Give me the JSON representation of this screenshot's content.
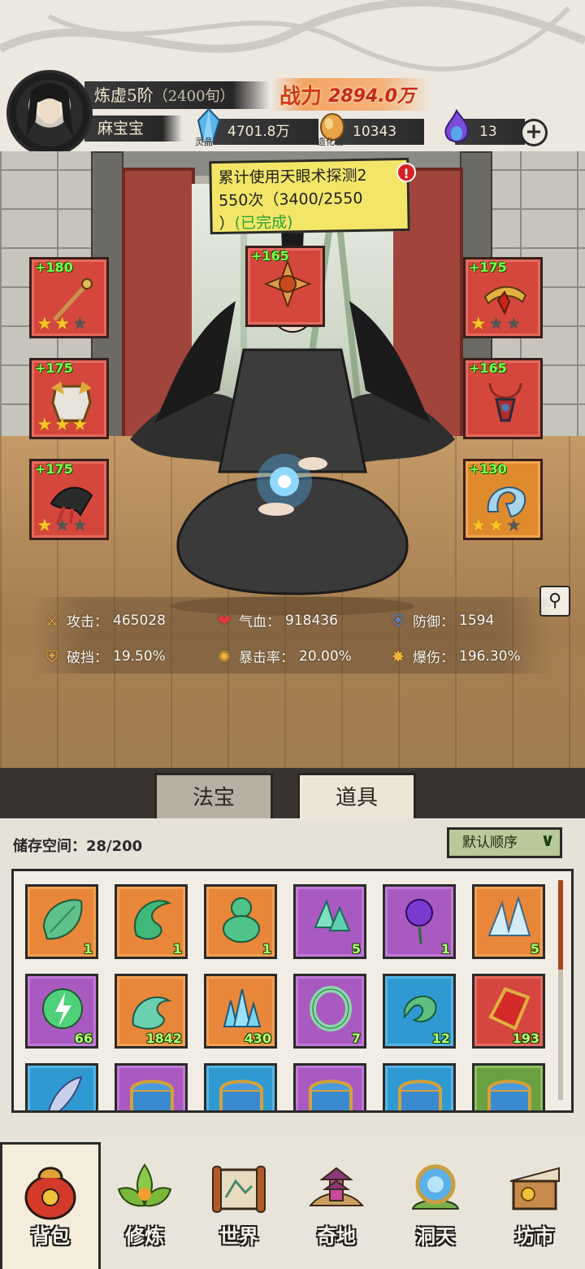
{
  "header": {
    "rank": "炼虚5阶",
    "rank_sub": "（2400旬）",
    "player_name": "麻宝宝",
    "power_label": "战力",
    "power_value": "2894.0万",
    "resources": [
      {
        "name": "灵晶",
        "value": "4701.8万",
        "icon": "blue-crystal-icon"
      },
      {
        "name": "造化石",
        "value": "10343",
        "icon": "amber-stone-icon"
      },
      {
        "name": "",
        "value": "13",
        "icon": "purple-flame-icon"
      }
    ]
  },
  "quest": {
    "line1": "累计使用天眼术探测2",
    "line2": "550次（3400/2550",
    "line3_prefix": "）",
    "line3_done": "(已完成)",
    "badge": "!"
  },
  "equipment": [
    {
      "slot": "left-1",
      "level": "+180",
      "stars": 2,
      "icon": "staff-icon",
      "color": "red"
    },
    {
      "slot": "left-2",
      "level": "+175",
      "stars": 3,
      "icon": "armor-icon",
      "color": "red"
    },
    {
      "slot": "left-3",
      "level": "+175",
      "stars": 1,
      "icon": "scarf-icon",
      "color": "red"
    },
    {
      "slot": "top",
      "level": "+165",
      "stars": 0,
      "icon": "amulet-icon",
      "color": "red"
    },
    {
      "slot": "right-1",
      "level": "+175",
      "stars": 1,
      "icon": "headband-icon",
      "color": "red"
    },
    {
      "slot": "right-2",
      "level": "+165",
      "stars": 0,
      "icon": "necklace-icon",
      "color": "red"
    },
    {
      "slot": "right-3",
      "level": "+130",
      "stars": 2,
      "icon": "dragon-bracelet-icon",
      "color": "orange"
    }
  ],
  "stats": {
    "attack_label": "攻击：",
    "attack_value": "465028",
    "hp_label": "气血：",
    "hp_value": "918436",
    "defense_label": "防御：",
    "defense_value": "1594",
    "break_label": "破挡：",
    "break_value": "19.50%",
    "crit_label": "暴击率：",
    "crit_value": "20.00%",
    "critdmg_label": "爆伤：",
    "critdmg_value": "196.30%"
  },
  "tabs": {
    "fabao": "法宝",
    "daoju": "道具",
    "active": "道具"
  },
  "inventory": {
    "storage_label": "储存空间：",
    "storage_value": "28/200",
    "sort_label": "默认顺序",
    "items": [
      {
        "name": "jade-leaf",
        "count": "1",
        "color": "orange"
      },
      {
        "name": "jade-swirl",
        "count": "1",
        "color": "orange"
      },
      {
        "name": "jade-gourd",
        "count": "1",
        "color": "orange"
      },
      {
        "name": "crystal-shards",
        "count": "5",
        "color": "purple"
      },
      {
        "name": "purple-rose",
        "count": "1",
        "color": "purple"
      },
      {
        "name": "ice-crystal",
        "count": "5",
        "color": "orange"
      },
      {
        "name": "thunder-orb",
        "count": "66",
        "color": "purple"
      },
      {
        "name": "cloud-spirit",
        "count": "1842",
        "color": "orange"
      },
      {
        "name": "blue-crystal-cluster",
        "count": "430",
        "color": "orange"
      },
      {
        "name": "jade-ring",
        "count": "7",
        "color": "purple"
      },
      {
        "name": "jade-dragon",
        "count": "12",
        "color": "blue"
      },
      {
        "name": "red-talisman",
        "count": "193",
        "color": "red"
      },
      {
        "name": "silver-feather",
        "count": "",
        "color": "blue"
      },
      {
        "name": "treasure-chest",
        "count": "",
        "color": "purple"
      },
      {
        "name": "treasure-chest",
        "count": "",
        "color": "blue"
      },
      {
        "name": "treasure-chest",
        "count": "",
        "color": "purple"
      },
      {
        "name": "treasure-chest",
        "count": "",
        "color": "blue"
      },
      {
        "name": "treasure-chest",
        "count": "",
        "color": "green"
      }
    ]
  },
  "nav": [
    {
      "label": "背包",
      "icon": "backpack-icon",
      "active": true
    },
    {
      "label": "修炼",
      "icon": "lotus-icon",
      "active": false
    },
    {
      "label": "世界",
      "icon": "scroll-map-icon",
      "active": false
    },
    {
      "label": "奇地",
      "icon": "pagoda-icon",
      "active": false
    },
    {
      "label": "洞天",
      "icon": "portal-icon",
      "active": false
    },
    {
      "label": "坊市",
      "icon": "market-stall-icon",
      "active": false
    }
  ]
}
